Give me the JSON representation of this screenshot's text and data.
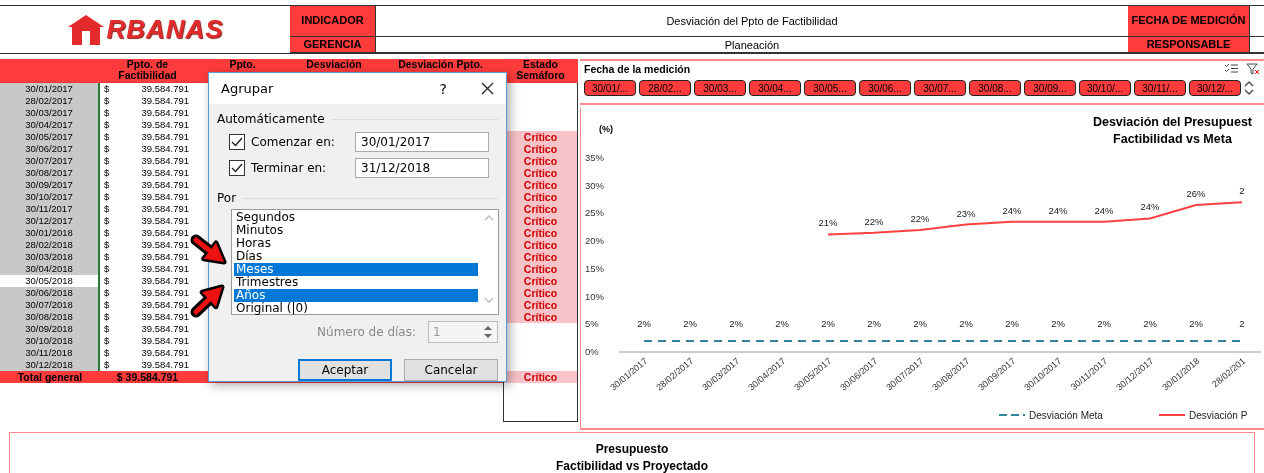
{
  "header": {
    "logo": "RBANAS",
    "rows": [
      {
        "label": "INDICADOR",
        "value": "Desviación del Ppto de Factibilidad",
        "side_label": "FECHA DE MEDICIÓN"
      },
      {
        "label": "GERENCIA",
        "value": "Planeación",
        "side_label": "RESPONSABLE"
      }
    ]
  },
  "table": {
    "columns": [
      "Ppto. de Factibilidad",
      "Ppto.",
      "Desviación",
      "Desviación Ppto.",
      "Estado Semáforo"
    ],
    "rows": [
      {
        "date": "30/01/2017",
        "shaded": true,
        "currency": "$",
        "amount": "39.584.791"
      },
      {
        "date": "28/02/2017",
        "shaded": true,
        "currency": "$",
        "amount": "39.584.791"
      },
      {
        "date": "30/03/2017",
        "shaded": true,
        "currency": "$",
        "amount": "39.584.791"
      },
      {
        "date": "30/04/2017",
        "shaded": true,
        "currency": "$",
        "amount": "39.584.791"
      },
      {
        "date": "30/05/2017",
        "shaded": true,
        "currency": "$",
        "amount": "39.584.791",
        "estado": "Crítico"
      },
      {
        "date": "30/06/2017",
        "shaded": true,
        "currency": "$",
        "amount": "39.584.791",
        "estado": "Crítico"
      },
      {
        "date": "30/07/2017",
        "shaded": true,
        "currency": "$",
        "amount": "39.584.791",
        "estado": "Crítico"
      },
      {
        "date": "30/08/2017",
        "shaded": true,
        "currency": "$",
        "amount": "39.584.791",
        "estado": "Crítico"
      },
      {
        "date": "30/09/2017",
        "shaded": true,
        "currency": "$",
        "amount": "39.584.791",
        "estado": "Crítico"
      },
      {
        "date": "30/10/2017",
        "shaded": true,
        "currency": "$",
        "amount": "39.584.791",
        "estado": "Crítico"
      },
      {
        "date": "30/11/2017",
        "shaded": true,
        "currency": "$",
        "amount": "39.584.791",
        "estado": "Crítico"
      },
      {
        "date": "30/12/2017",
        "shaded": true,
        "currency": "$",
        "amount": "39.584.791",
        "estado": "Crítico"
      },
      {
        "date": "30/01/2018",
        "shaded": true,
        "currency": "$",
        "amount": "39.584.791",
        "estado": "Crítico"
      },
      {
        "date": "28/02/2018",
        "shaded": true,
        "currency": "$",
        "amount": "39.584.791",
        "estado": "Crítico"
      },
      {
        "date": "30/03/2018",
        "shaded": true,
        "currency": "$",
        "amount": "39.584.791",
        "estado": "Crítico"
      },
      {
        "date": "30/04/2018",
        "shaded": true,
        "currency": "$",
        "amount": "39.584.791",
        "estado": "Crítico"
      },
      {
        "date": "30/05/2018",
        "shaded": false,
        "currency": "$",
        "amount": "39.584.791",
        "estado": "Crítico"
      },
      {
        "date": "30/06/2018",
        "shaded": true,
        "currency": "$",
        "amount": "39.584.791",
        "estado": "Crítico"
      },
      {
        "date": "30/07/2018",
        "shaded": true,
        "currency": "$",
        "amount": "39.584.791",
        "estado": "Crítico"
      },
      {
        "date": "30/08/2018",
        "shaded": true,
        "currency": "$",
        "amount": "39.584.791",
        "estado": "Crítico"
      },
      {
        "date": "30/09/2018",
        "shaded": true,
        "currency": "$",
        "amount": "39.584.791"
      },
      {
        "date": "30/10/2018",
        "shaded": true,
        "currency": "$",
        "amount": "39.584.791"
      },
      {
        "date": "30/11/2018",
        "shaded": true,
        "currency": "$",
        "amount": "39.584.791"
      },
      {
        "date": "30/12/2018",
        "shaded": true,
        "currency": "$",
        "amount": "39.584.791"
      }
    ],
    "total": {
      "label": "Total general",
      "amount": "$ 39.584.791",
      "estado": "Crítico"
    }
  },
  "dialog": {
    "title": "Agrupar",
    "help": "?",
    "section_auto": "Automáticamente",
    "fields": [
      {
        "label": "Comenzar en:",
        "checked": true,
        "value": "30/01/2017"
      },
      {
        "label": "Terminar en:",
        "checked": true,
        "value": "31/12/2018"
      }
    ],
    "section_by": "Por",
    "list": [
      {
        "label": "Segundos",
        "selected": false
      },
      {
        "label": "Minutos",
        "selected": false
      },
      {
        "label": "Horas",
        "selected": false
      },
      {
        "label": "Días",
        "selected": false
      },
      {
        "label": "Meses",
        "selected": true
      },
      {
        "label": "Trimestres",
        "selected": false
      },
      {
        "label": "Años",
        "selected": true
      },
      {
        "label": "Original (|0)",
        "selected": false
      }
    ],
    "days": {
      "label": "Número de días:",
      "value": "1",
      "disabled": true
    },
    "buttons": [
      "Aceptar",
      "Cancelar"
    ]
  },
  "slicer": {
    "title": "Fecha de la medición",
    "buttons": [
      {
        "label": "30/01/...",
        "selected": true
      },
      {
        "label": "28/02...",
        "selected": true
      },
      {
        "label": "30/03...",
        "selected": true
      },
      {
        "label": "30/04...",
        "selected": true
      },
      {
        "label": "30/05...",
        "selected": true
      },
      {
        "label": "30/06...",
        "selected": true
      },
      {
        "label": "30/07...",
        "selected": true
      },
      {
        "label": "30/08...",
        "selected": true
      },
      {
        "label": "30/09...",
        "selected": true
      },
      {
        "label": "30/10/...",
        "selected": true
      },
      {
        "label": "30/11/...",
        "selected": true
      },
      {
        "label": "30/12/...",
        "selected": true
      }
    ]
  },
  "chart": {
    "chart_data": {
      "type": "line",
      "title": "Desviación del Presupuest\nFactibilidad vs Meta",
      "ylabel": "(%)",
      "categories": [
        "30/01/2017",
        "28/02/2017",
        "30/03/2017",
        "30/04/2017",
        "30/05/2017",
        "30/06/2017",
        "30/07/2017",
        "30/08/2017",
        "30/09/2017",
        "30/10/2017",
        "30/11/2017",
        "30/12/2017",
        "30/01/2018",
        "28/02/201"
      ],
      "ylim": [
        0,
        0.35
      ],
      "yticks": [
        {
          "value": 0,
          "label": "0%"
        },
        {
          "value": 0.05,
          "label": "5%"
        },
        {
          "value": 0.1,
          "label": "10%"
        },
        {
          "value": 0.15,
          "label": "15%"
        },
        {
          "value": 0.2,
          "label": "20%"
        },
        {
          "value": 0.25,
          "label": "25%"
        },
        {
          "value": 0.3,
          "label": "30%"
        },
        {
          "value": 0.35,
          "label": "35%"
        }
      ],
      "legend": true,
      "series": [
        {
          "name": "Desviación Meta",
          "color": "#31849b",
          "line_style": "dashed",
          "values": [
            0.02,
            0.02,
            0.02,
            0.02,
            0.02,
            0.02,
            0.02,
            0.02,
            0.02,
            0.02,
            0.02,
            0.02,
            0.02,
            0.02
          ]
        },
        {
          "name": "Desviación P",
          "color": "#ff4040",
          "line_style": "solid",
          "values": [
            null,
            null,
            null,
            null,
            0.212,
            0.215,
            0.22,
            0.23,
            0.235,
            0.235,
            0.235,
            0.241,
            0.265,
            0.27
          ]
        }
      ],
      "value_labels": [
        [
          "2%",
          "2%",
          "2%",
          "2%",
          "2%",
          "2%",
          "2%",
          "2%",
          "2%",
          "2%",
          "2%",
          "2%",
          "2%",
          "2"
        ],
        [
          null,
          null,
          null,
          null,
          "21%",
          "22%",
          "22%",
          "23%",
          "24%",
          "24%",
          "24%",
          "24%",
          "26%",
          "2"
        ]
      ]
    }
  },
  "bottom": {
    "title": "Presupuesto\nFactibilidad vs Proyectado"
  }
}
